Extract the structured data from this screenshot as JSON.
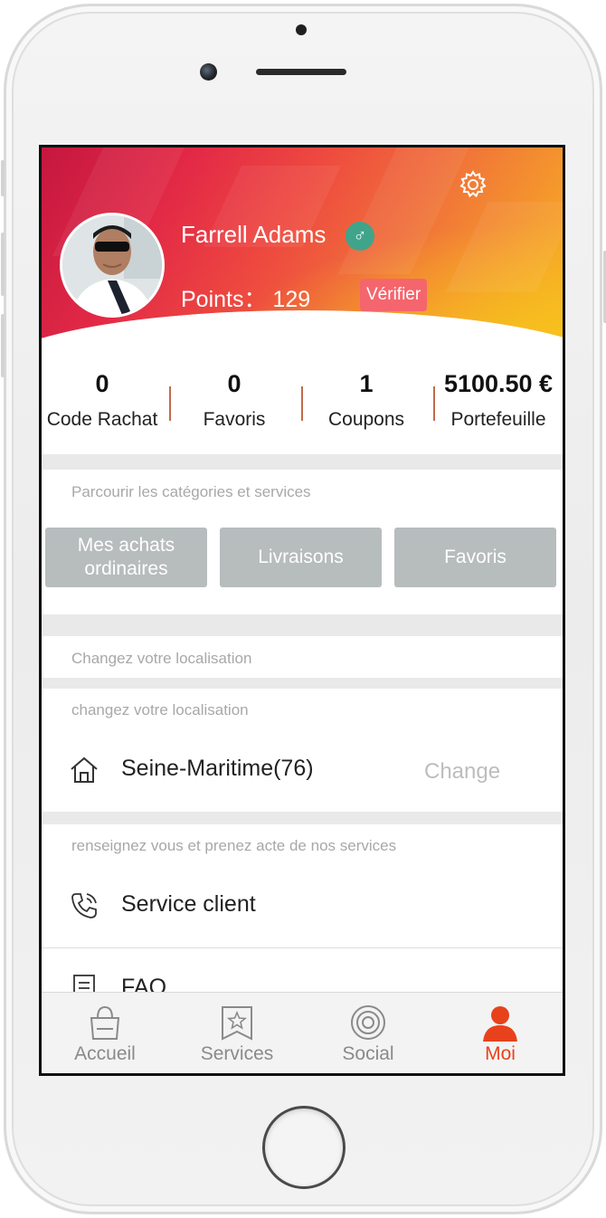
{
  "profile": {
    "name": "Farrell Adams",
    "points_text": "Points： 129",
    "verify_label": "Vérifier"
  },
  "stats": [
    {
      "value": "0",
      "label": "Code Rachat"
    },
    {
      "value": "0",
      "label": "Favoris"
    },
    {
      "value": "1",
      "label": "Coupons"
    },
    {
      "value": "5100.50 €",
      "label": "Portefeuille"
    }
  ],
  "categories": {
    "header": "Parcourir les catégories  et services",
    "buttons": [
      {
        "label": "Mes achats ordinaires"
      },
      {
        "label": "Livraisons"
      },
      {
        "label": "Favoris"
      }
    ]
  },
  "location": {
    "section_title": "Changez votre localisation",
    "subtitle": "changez votre localisation",
    "value": "Seine-Maritime(76)",
    "change_label": "Change"
  },
  "services": {
    "subtitle": "renseignez vous et prenez acte de nos services",
    "items": [
      {
        "label": "Service client",
        "icon": "phone-icon"
      },
      {
        "label": "FAQ",
        "icon": "document-icon"
      }
    ]
  },
  "tabs": [
    {
      "label": "Accueil",
      "icon": "shopping-bag-icon",
      "active": false
    },
    {
      "label": "Services",
      "icon": "star-bookmark-icon",
      "active": false
    },
    {
      "label": "Social",
      "icon": "target-icon",
      "active": false
    },
    {
      "label": "Moi",
      "icon": "person-icon",
      "active": true
    }
  ],
  "colors": {
    "accent": "#e8421c",
    "header_gradient_start": "#c5173f",
    "header_gradient_end": "#f7b423",
    "verify_button": "#f5656d",
    "gender_badge": "#3fa48a",
    "category_button": "#b7bcbd"
  }
}
